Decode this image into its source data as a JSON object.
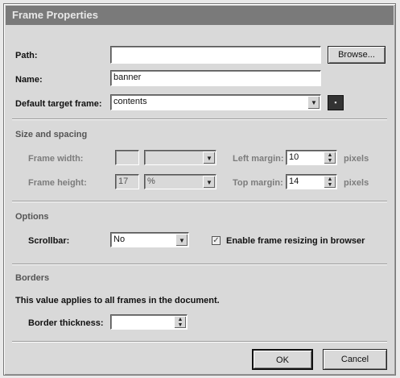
{
  "window": {
    "title": "Frame Properties"
  },
  "path": {
    "label": "Path:",
    "value": "",
    "browse_label": "Browse..."
  },
  "name": {
    "label": "Name:",
    "value": "banner"
  },
  "target": {
    "label": "Default target frame:",
    "value": "contents"
  },
  "size_spacing": {
    "heading": "Size and spacing",
    "frame_width": {
      "label": "Frame width:",
      "value": "",
      "unit": ""
    },
    "frame_height": {
      "label": "Frame height:",
      "value": "17",
      "unit": "%"
    },
    "left_margin": {
      "label": "Left margin:",
      "value": "10",
      "unit": "pixels"
    },
    "top_margin": {
      "label": "Top margin:",
      "value": "14",
      "unit": "pixels"
    }
  },
  "options": {
    "heading": "Options",
    "scrollbar": {
      "label": "Scrollbar:",
      "value": "No"
    },
    "resize": {
      "label": "Enable frame resizing in browser",
      "checked": true
    }
  },
  "borders": {
    "heading": "Borders",
    "note": "This value applies to all frames in the document.",
    "thickness": {
      "label": "Border thickness:",
      "value": ""
    }
  },
  "buttons": {
    "ok": "OK",
    "cancel": "Cancel"
  }
}
